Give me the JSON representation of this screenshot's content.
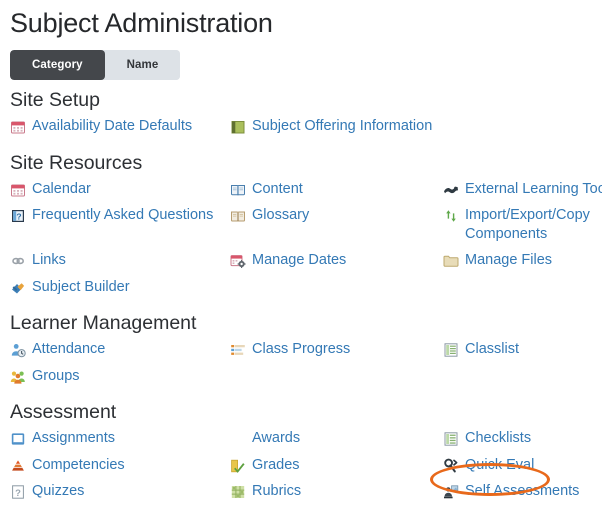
{
  "page": {
    "title": "Subject Administration"
  },
  "tabs": [
    {
      "label": "Category",
      "active": true
    },
    {
      "label": "Name",
      "active": false
    }
  ],
  "colors": {
    "link": "#3479b5",
    "heading": "#2d3034",
    "tab_active_bg": "#44474b",
    "tab_inactive_bg": "#dde2e7",
    "highlight": "#e8691b"
  },
  "highlight": {
    "target_label": "Quick Eval",
    "shape": "ellipse",
    "color": "#e8691b"
  },
  "sections": [
    {
      "title": "Site Setup",
      "rows": [
        [
          {
            "label": "Availability Date Defaults",
            "icon": "calendar-icon"
          },
          {
            "label": "Subject Offering Information",
            "icon": "green-square-icon"
          },
          null
        ]
      ]
    },
    {
      "title": "Site Resources",
      "rows": [
        [
          {
            "label": "Calendar",
            "icon": "calendar-icon"
          },
          {
            "label": "Content",
            "icon": "book-icon"
          },
          {
            "label": "External Learning Tools",
            "icon": "plug-icon",
            "clipped": true
          }
        ],
        [
          {
            "label": "Frequently Asked Questions",
            "icon": "faq-icon"
          },
          {
            "label": "Glossary",
            "icon": "glossary-book-icon"
          },
          {
            "label": "Import/Export/Copy Components",
            "icon": "import-export-icon",
            "wrap": true
          }
        ],
        [
          {
            "label": "Links",
            "icon": "links-icon"
          },
          {
            "label": "Manage Dates",
            "icon": "manage-dates-icon"
          },
          {
            "label": "Manage Files",
            "icon": "folder-icon"
          }
        ],
        [
          {
            "label": "Subject Builder",
            "icon": "subject-builder-icon"
          },
          null,
          null
        ]
      ]
    },
    {
      "title": "Learner Management",
      "rows": [
        [
          {
            "label": "Attendance",
            "icon": "attendance-icon"
          },
          {
            "label": "Class Progress",
            "icon": "class-progress-icon"
          },
          {
            "label": "Classlist",
            "icon": "classlist-icon"
          }
        ],
        [
          {
            "label": "Groups",
            "icon": "groups-icon"
          },
          null,
          null
        ]
      ]
    },
    {
      "title": "Assessment",
      "rows": [
        [
          {
            "label": "Assignments",
            "icon": "assignments-icon"
          },
          {
            "label": "Awards",
            "icon": "awards-icon"
          },
          {
            "label": "Checklists",
            "icon": "checklists-icon"
          }
        ],
        [
          {
            "label": "Competencies",
            "icon": "competencies-icon"
          },
          {
            "label": "Grades",
            "icon": "grades-icon"
          },
          {
            "label": "Quick Eval",
            "icon": "quick-eval-icon",
            "highlighted": true
          }
        ],
        [
          {
            "label": "Quizzes",
            "icon": "quizzes-icon"
          },
          {
            "label": "Rubrics",
            "icon": "rubrics-icon"
          },
          {
            "label": "Self Assessments",
            "icon": "self-assessments-icon"
          }
        ]
      ]
    }
  ]
}
